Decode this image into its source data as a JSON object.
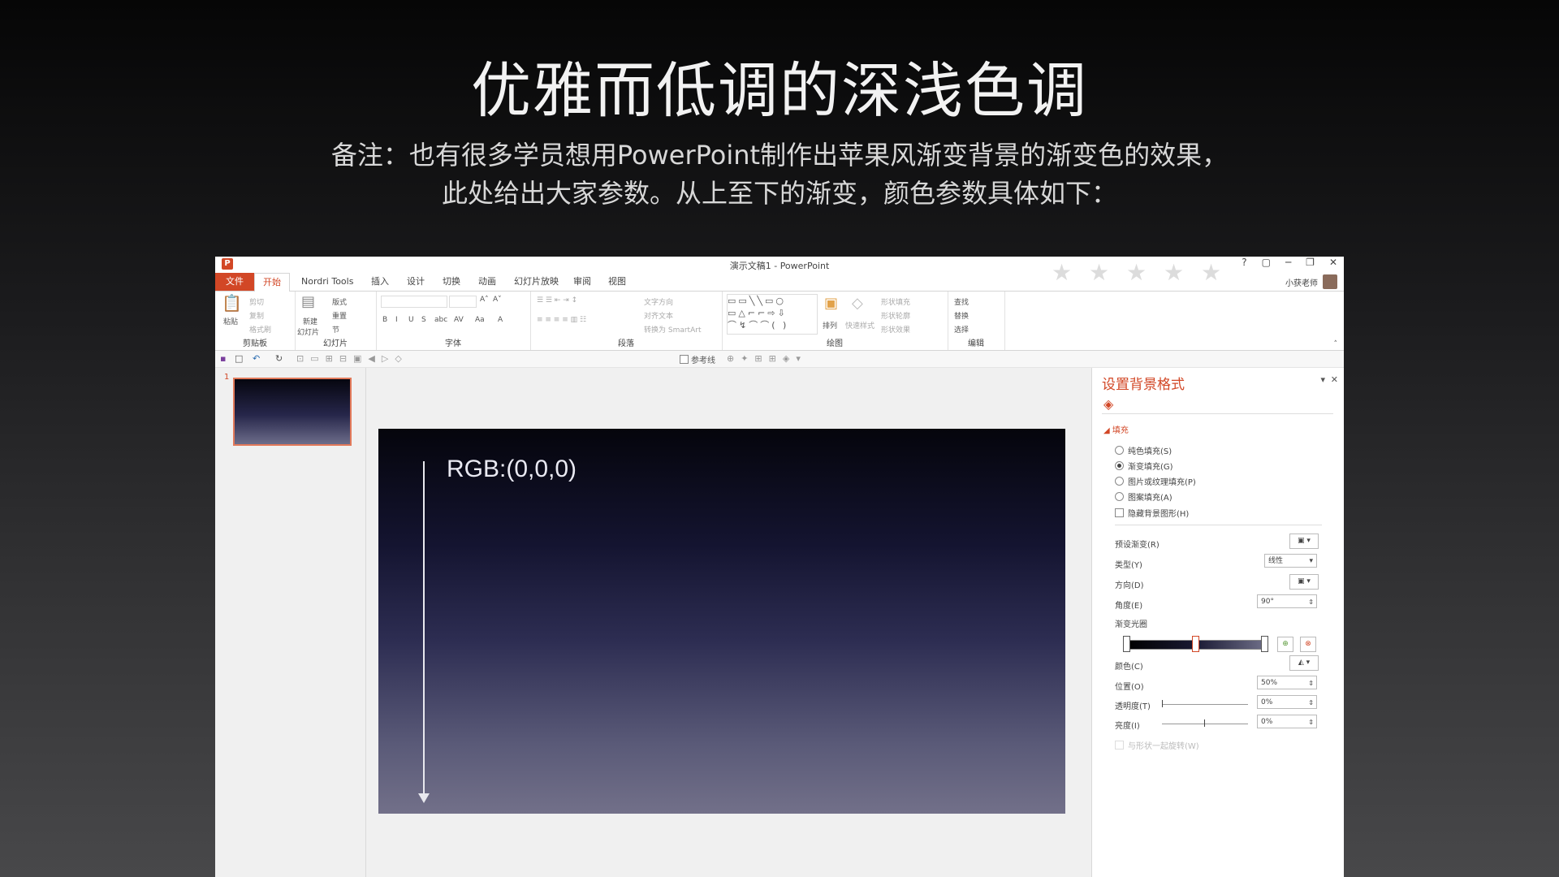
{
  "slide": {
    "title": "优雅而低调的深浅色调",
    "note_line1": "备注：也有很多学员想用PowerPoint制作出苹果风渐变背景的渐变色的效果，",
    "note_line2": "此处给出大家参数。从上至下的渐变，颜色参数具体如下："
  },
  "window": {
    "title": "演示文稿1 - PowerPoint",
    "logo": "P",
    "controls": [
      "?",
      "▢",
      "─",
      "❐",
      "✕"
    ],
    "user": "小获老师"
  },
  "menu": {
    "file": "文件",
    "tabs": [
      "开始",
      "Nordri Tools",
      "插入",
      "设计",
      "切换",
      "动画",
      "幻灯片放映",
      "审阅",
      "视图"
    ]
  },
  "ribbon": {
    "clipboard": {
      "label": "剪贴板",
      "paste": "粘贴",
      "cut": "剪切",
      "copy": "复制",
      "format": "格式刷"
    },
    "slides": {
      "label": "幻灯片",
      "new": "新建",
      "new2": "幻灯片",
      "layout": "版式",
      "reset": "重置",
      "section": "节"
    },
    "font": {
      "label": "字体",
      "bold": "B",
      "italic": "I",
      "underline": "U",
      "strike": "S",
      "abc": "abc",
      "av": "AV",
      "aa": "Aa",
      "a": "A",
      "grow": "A˄",
      "shrink": "A˅"
    },
    "paragraph": {
      "label": "段落",
      "text_dir": "文字方向",
      "align_text": "对齐文本",
      "smartart": "转换为 SmartArt"
    },
    "drawing": {
      "label": "绘图",
      "arrange": "排列",
      "quick_styles": "快速样式",
      "fill": "形状填充",
      "outline": "形状轮廓",
      "effects": "形状效果"
    },
    "editing": {
      "label": "编辑",
      "find": "查找",
      "replace": "替换",
      "select": "选择"
    }
  },
  "qat": {
    "guides": "参考线"
  },
  "thumbnail": {
    "number": "1"
  },
  "canvas": {
    "annotation": "RGB:(0,0,0)"
  },
  "pane": {
    "title": "设置背景格式",
    "section": "填充",
    "fill_options": [
      {
        "label": "纯色填充(S)",
        "selected": false
      },
      {
        "label": "渐变填充(G)",
        "selected": true
      },
      {
        "label": "图片或纹理填充(P)",
        "selected": false
      },
      {
        "label": "图案填充(A)",
        "selected": false
      }
    ],
    "hide_bg": "隐藏背景图形(H)",
    "preset_label": "预设渐变(R)",
    "type_label": "类型(Y)",
    "type_value": "线性",
    "direction_label": "方向(D)",
    "angle_label": "角度(E)",
    "angle_value": "90°",
    "stops_label": "渐变光圈",
    "color_label": "颜色(C)",
    "position_label": "位置(O)",
    "position_value": "50%",
    "transparency_label": "透明度(T)",
    "transparency_value": "0%",
    "brightness_label": "亮度(I)",
    "brightness_value": "0%",
    "rotate_label": "与形状一起旋转(W)"
  },
  "colors": {
    "accent": "#d24726"
  }
}
